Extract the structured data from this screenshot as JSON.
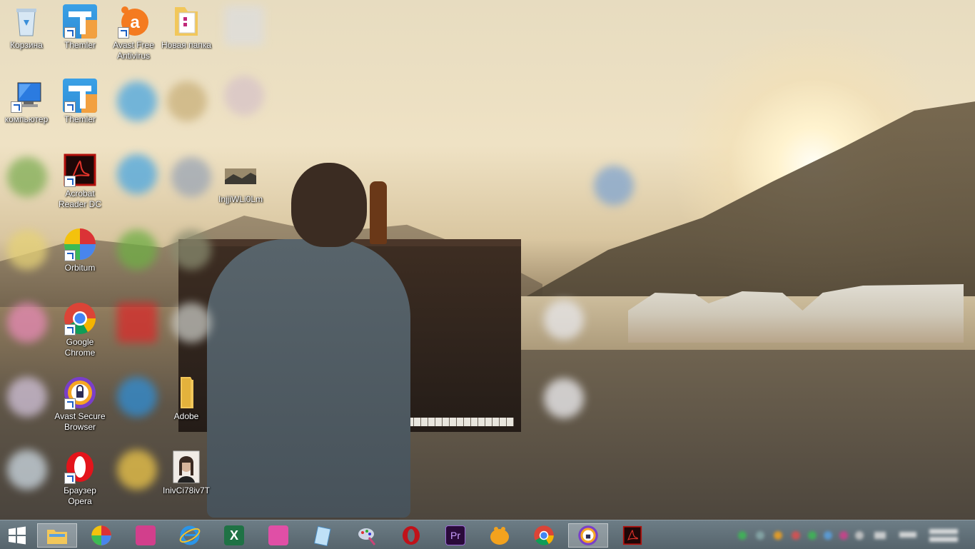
{
  "desktop": {
    "icons": [
      {
        "label": "Корзина"
      },
      {
        "label": "Themler"
      },
      {
        "label": "Avast Free Antivirus"
      },
      {
        "label": "Новая папка"
      },
      {
        "label": "компьютер"
      },
      {
        "label": "Themler"
      },
      {
        "label": "Acrobat Reader DC"
      },
      {
        "label": "InjjiWLi0Lm"
      },
      {
        "label": "Orbitum"
      },
      {
        "label": "Google Chrome"
      },
      {
        "label": "Avast Secure Browser"
      },
      {
        "label": "Adobe"
      },
      {
        "label": "Браузер Opera"
      },
      {
        "label": "InivCi78iv7T"
      }
    ]
  },
  "taskbar": {
    "start_icon": "windows-logo",
    "items": [
      {
        "icon": "file-explorer"
      },
      {
        "icon": "orbitum"
      },
      {
        "icon": "pink-app"
      },
      {
        "icon": "internet-explorer"
      },
      {
        "icon": "excel"
      },
      {
        "icon": "pink-app-2"
      },
      {
        "icon": "notepad"
      },
      {
        "icon": "paint-tool"
      },
      {
        "icon": "opera"
      },
      {
        "icon": "premiere-pro"
      },
      {
        "icon": "orange-app"
      },
      {
        "icon": "chrome"
      },
      {
        "icon": "avast-secure-browser"
      },
      {
        "icon": "acrobat-reader"
      }
    ],
    "excel_letter": "X",
    "premiere_letters": "Pr"
  },
  "colors": {
    "taskbar": "#5f6e77",
    "avast_orange": "#f47b20",
    "acrobat_red": "#b1100c",
    "premiere_purple": "#2a0a3a",
    "excel_green": "#1f7245"
  }
}
